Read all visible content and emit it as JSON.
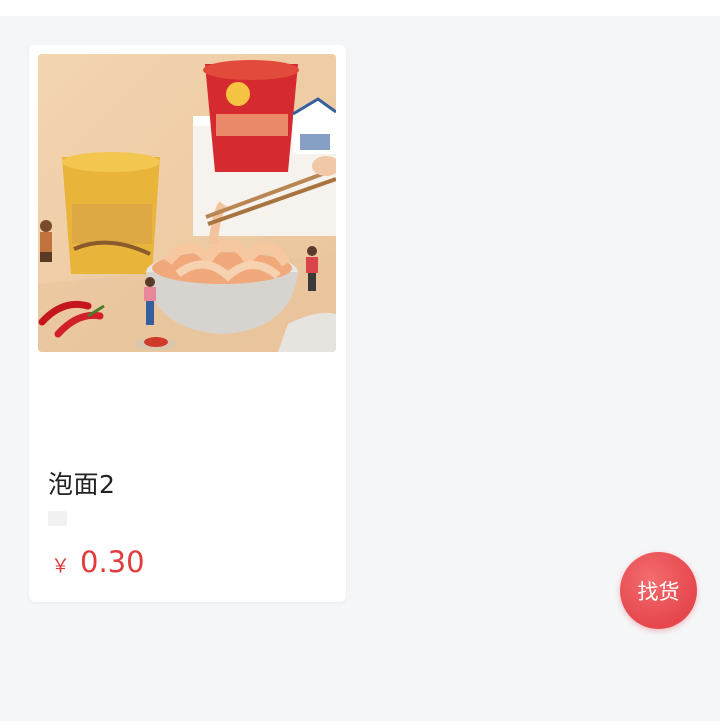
{
  "product": {
    "name": "泡面2",
    "currency": "￥",
    "price": "0.30",
    "image": "instant-noodle-product-photo"
  },
  "fab": {
    "label": "找货"
  },
  "colors": {
    "price": "#e23b3b",
    "fab": "#e5474d",
    "background": "#f5f6f8"
  }
}
